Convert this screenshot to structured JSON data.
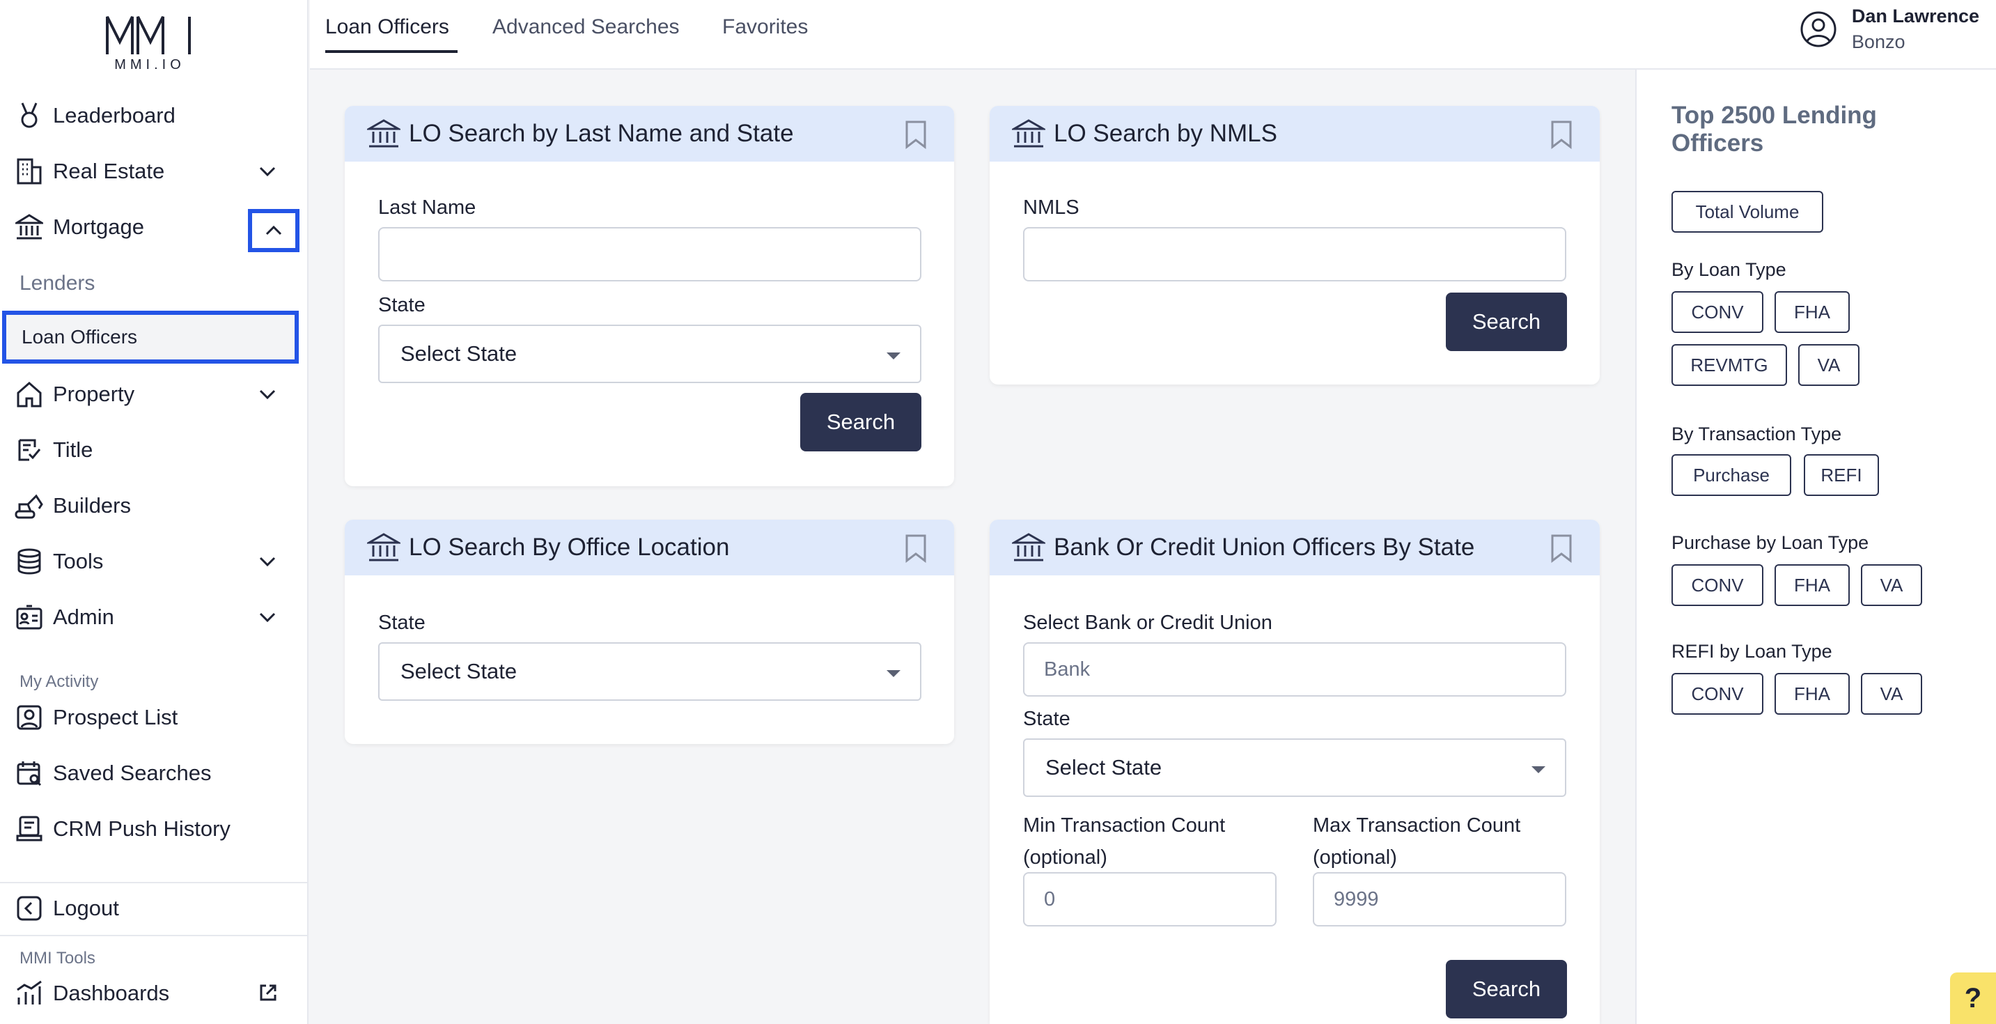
{
  "brand": {
    "logo_text": "MMI.IO"
  },
  "sidebar": {
    "items": [
      {
        "label": "Leaderboard",
        "icon": "medal-icon"
      },
      {
        "label": "Real Estate",
        "icon": "building-icon"
      },
      {
        "label": "Mortgage",
        "icon": "bank-icon"
      },
      {
        "label": "Property",
        "icon": "home-icon"
      },
      {
        "label": "Title",
        "icon": "title-check-icon"
      },
      {
        "label": "Builders",
        "icon": "excavator-icon"
      },
      {
        "label": "Tools",
        "icon": "database-icon"
      },
      {
        "label": "Admin",
        "icon": "id-card-icon"
      }
    ],
    "mortgage_sub": {
      "lenders": "Lenders",
      "loan_officers": "Loan Officers"
    },
    "my_activity_label": "My Activity",
    "activity": [
      {
        "label": "Prospect List",
        "icon": "user-square-icon"
      },
      {
        "label": "Saved Searches",
        "icon": "calendar-search-icon"
      },
      {
        "label": "CRM Push History",
        "icon": "crm-icon"
      }
    ],
    "logout": "Logout",
    "mmi_tools_label": "MMI Tools",
    "dashboards": "Dashboards"
  },
  "header": {
    "tabs": [
      "Loan Officers",
      "Advanced Searches",
      "Favorites"
    ],
    "active_tab": "Loan Officers",
    "user_name": "Dan Lawrence",
    "user_org": "Bonzo"
  },
  "cards": {
    "last_name_state": {
      "title": "LO Search by Last Name and State",
      "last_name_label": "Last Name",
      "last_name_value": "",
      "state_label": "State",
      "state_value": "Select State",
      "search_label": "Search"
    },
    "nmls": {
      "title": "LO Search by NMLS",
      "nmls_label": "NMLS",
      "nmls_value": "",
      "search_label": "Search"
    },
    "office_location": {
      "title": "LO Search By Office Location",
      "state_label": "State",
      "state_value": "Select State"
    },
    "bank_cu": {
      "title": "Bank Or Credit Union Officers By State",
      "bank_label": "Select Bank or Credit Union",
      "bank_placeholder": "Bank",
      "state_label": "State",
      "state_value": "Select State",
      "min_label_1": "Min Transaction Count",
      "min_label_2": "(optional)",
      "min_placeholder": "0",
      "max_label_1": "Max Transaction Count",
      "max_label_2": "(optional)",
      "max_placeholder": "9999",
      "search_label": "Search"
    }
  },
  "right_panel": {
    "title": "Top 2500 Lending Officers",
    "total_volume": "Total Volume",
    "by_loan_type_label": "By Loan Type",
    "by_loan_type": [
      "CONV",
      "FHA",
      "REVMTG",
      "VA"
    ],
    "by_transaction_type_label": "By Transaction Type",
    "by_transaction_type": [
      "Purchase",
      "REFI"
    ],
    "purchase_by_loan_type_label": "Purchase by Loan Type",
    "purchase_by_loan_type": [
      "CONV",
      "FHA",
      "VA"
    ],
    "refi_by_loan_type_label": "REFI by Loan Type",
    "refi_by_loan_type": [
      "CONV",
      "FHA",
      "VA"
    ]
  },
  "help": {
    "label": "?"
  },
  "colors": {
    "accent": "#2354e6",
    "button": "#2c3350",
    "card_header": "#dfe9fb",
    "help": "#f9e26a"
  }
}
